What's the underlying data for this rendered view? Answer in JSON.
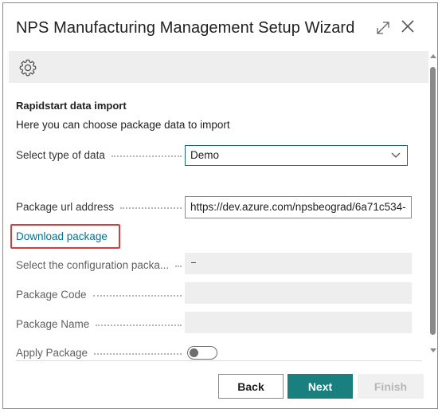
{
  "window": {
    "title": "NPS Manufacturing Management Setup Wizard",
    "expand_icon": "expand-icon",
    "close_icon": "close-icon"
  },
  "action_bar": {
    "icon": "gear-icon"
  },
  "section": {
    "title": "Rapidstart data import",
    "description": "Here you can choose package data to import"
  },
  "fields": {
    "type_of_data": {
      "label": "Select type of data",
      "value": "Demo"
    },
    "package_url": {
      "label": "Package url address",
      "value": "https://dev.azure.com/npsbeograd/6a71c534-"
    },
    "config_package": {
      "label": "Select the configuration packa...",
      "value": ""
    },
    "package_code": {
      "label": "Package Code",
      "value": ""
    },
    "package_name": {
      "label": "Package Name",
      "value": ""
    },
    "apply_package": {
      "label": "Apply Package",
      "value": false
    }
  },
  "links": {
    "download_package": "Download package"
  },
  "buttons": {
    "back": "Back",
    "next": "Next",
    "finish": "Finish"
  },
  "colors": {
    "accent": "#1a7f7f",
    "link": "#00728f",
    "highlight": "#e0393b",
    "action_bar_bg": "#eeeeee"
  }
}
